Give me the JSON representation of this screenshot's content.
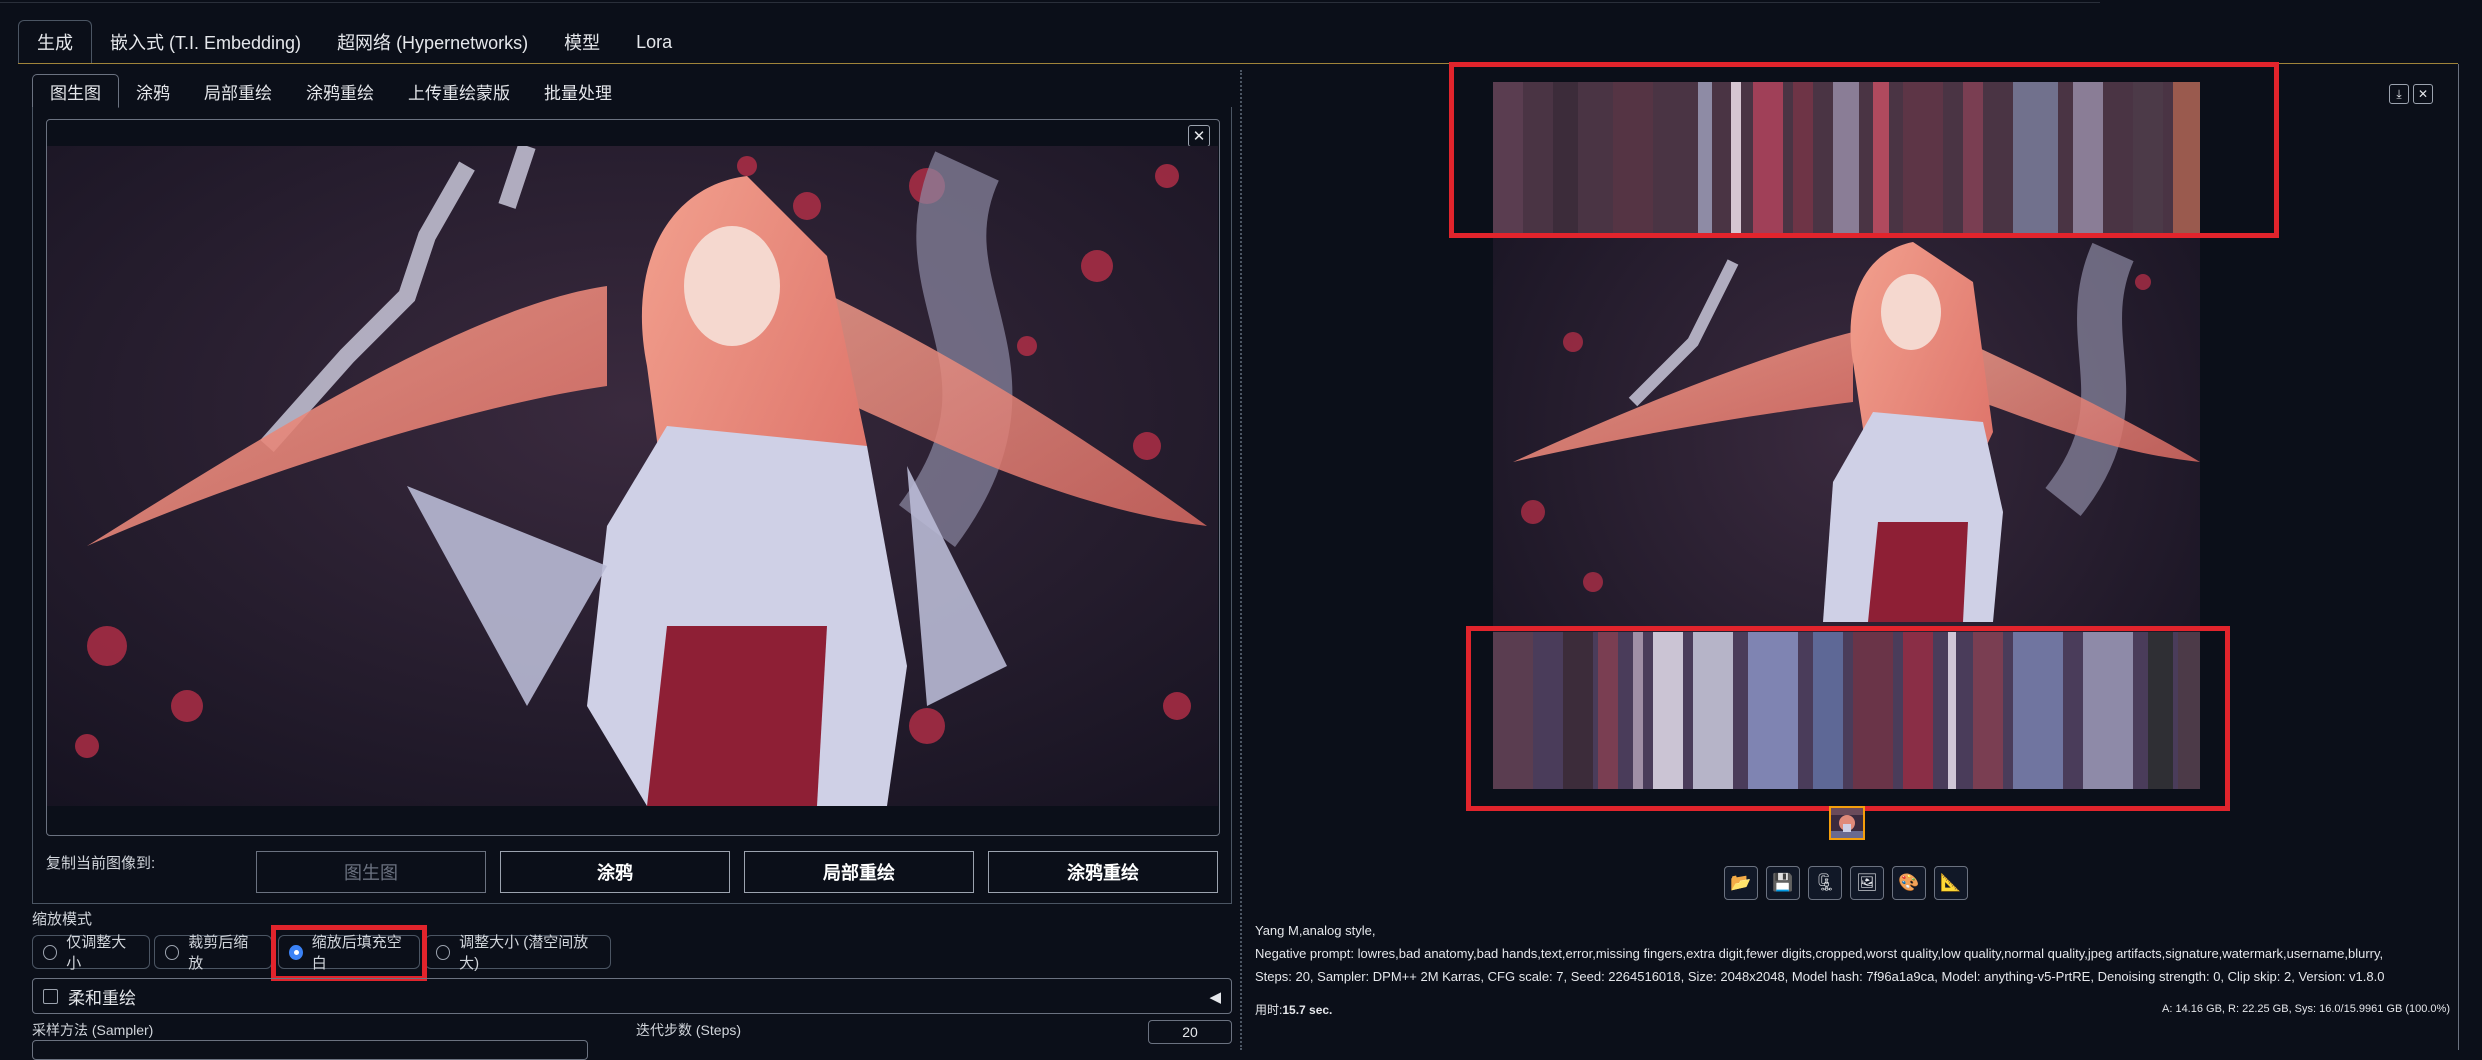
{
  "main_tabs": [
    "生成",
    "嵌入式 (T.I. Embedding)",
    "超网络 (Hypernetworks)",
    "模型",
    "Lora"
  ],
  "sub_tabs": [
    "图生图",
    "涂鸦",
    "局部重绘",
    "涂鸦重绘",
    "上传重绘蒙版",
    "批量处理"
  ],
  "copy_label": "复制当前图像到:",
  "copy_buttons": [
    "图生图",
    "涂鸦",
    "局部重绘",
    "涂鸦重绘"
  ],
  "resize_mode": {
    "label": "缩放模式",
    "options": [
      "仅调整大小",
      "裁剪后缩放",
      "缩放后填充空白",
      "调整大小 (潜空间放大)"
    ],
    "selected": "缩放后填充空白"
  },
  "soft_inpaint": "柔和重绘",
  "sampler_label": "采样方法 (Sampler)",
  "steps_label": "迭代步数 (Steps)",
  "steps_value": "20",
  "generation_info": {
    "prompt": "Yang M,analog style,",
    "negative": "Negative prompt: lowres,bad anatomy,bad hands,text,error,missing fingers,extra digit,fewer digits,cropped,worst quality,low quality,normal quality,jpeg artifacts,signature,watermark,username,blurry,",
    "params": "Steps: 20, Sampler: DPM++ 2M Karras, CFG scale: 7, Seed: 2264516018, Size: 2048x2048, Model hash: 7f96a1a9ca, Model: anything-v5-PrtRE, Denoising strength: 0, Clip skip: 2, Version: v1.8.0"
  },
  "timing": {
    "label": "用时:",
    "value": "15.7 sec."
  },
  "vram": "A: 14.16 GB, R: 22.25 GB, Sys: 16.0/15.9961 GB (100.0%)",
  "tool_icons": [
    "folder-icon",
    "save-icon",
    "zip-icon",
    "image-icon",
    "palette-icon",
    "ruler-icon"
  ],
  "colors": {
    "background": "#0b0f19",
    "accent_line": "#a0843a",
    "highlight": "#e2242c",
    "selected_radio": "#3b82f6",
    "thumb_border": "#f59e0b"
  }
}
